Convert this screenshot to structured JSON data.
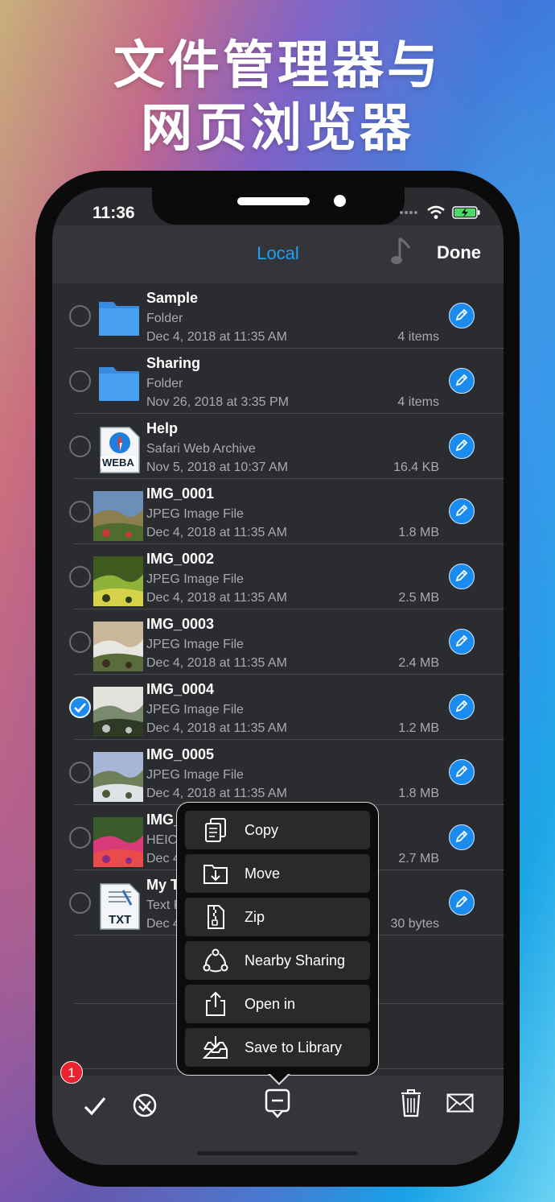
{
  "headline": {
    "line1": "文件管理器与",
    "line2": "网页浏览器"
  },
  "status_bar": {
    "time": "11:36"
  },
  "nav": {
    "title": "Local",
    "done": "Done"
  },
  "files": [
    {
      "name": "Sample",
      "kind": "Folder",
      "date": "Dec 4, 2018 at 11:35 AM",
      "size": "4 items",
      "thumb": "folder-icon",
      "checked": false
    },
    {
      "name": "Sharing",
      "kind": "Folder",
      "date": "Nov 26, 2018 at 3:35 PM",
      "size": "4 items",
      "thumb": "folder-icon",
      "checked": false
    },
    {
      "name": "Help",
      "kind": "Safari Web Archive",
      "date": "Nov 5, 2018 at 10:37 AM",
      "size": "16.4 KB",
      "thumb": "webarchive-icon",
      "thumb_label": "WEBA",
      "checked": false
    },
    {
      "name": "IMG_0001",
      "kind": "JPEG Image File",
      "date": "Dec 4, 2018 at 11:35 AM",
      "size": "1.8 MB",
      "thumb": "photo-thumbnail",
      "checked": false
    },
    {
      "name": "IMG_0002",
      "kind": "JPEG Image File",
      "date": "Dec 4, 2018 at 11:35 AM",
      "size": "2.5 MB",
      "thumb": "photo-thumbnail",
      "checked": false
    },
    {
      "name": "IMG_0003",
      "kind": "JPEG Image File",
      "date": "Dec 4, 2018 at 11:35 AM",
      "size": "2.4 MB",
      "thumb": "photo-thumbnail",
      "checked": false
    },
    {
      "name": "IMG_0004",
      "kind": "JPEG Image File",
      "date": "Dec 4, 2018 at 11:35 AM",
      "size": "1.2 MB",
      "thumb": "photo-thumbnail",
      "checked": true
    },
    {
      "name": "IMG_0005",
      "kind": "JPEG Image File",
      "date": "Dec 4, 2018 at 11:35 AM",
      "size": "1.8 MB",
      "thumb": "photo-thumbnail",
      "checked": false
    },
    {
      "name": "IMG_",
      "kind": "HEIC",
      "date": "Dec 4,",
      "size": "2.7 MB",
      "thumb": "photo-thumbnail",
      "checked": false
    },
    {
      "name": "My T",
      "kind": "Text F",
      "date": "Dec 4,",
      "size": "30 bytes",
      "thumb": "text-file-icon",
      "thumb_label": "TXT",
      "checked": false
    }
  ],
  "context_menu": [
    {
      "label": "Copy",
      "icon": "copy-icon"
    },
    {
      "label": "Move",
      "icon": "move-icon"
    },
    {
      "label": "Zip",
      "icon": "zip-icon"
    },
    {
      "label": "Nearby Sharing",
      "icon": "nearby-sharing-icon"
    },
    {
      "label": "Open in",
      "icon": "share-icon"
    },
    {
      "label": "Save to Library",
      "icon": "save-to-library-icon"
    }
  ],
  "toolbar": {
    "selected_count": "1"
  },
  "colors": {
    "accent": "#1a8cf0",
    "list_bg": "#2b2c30",
    "bar_bg": "#34353a"
  }
}
